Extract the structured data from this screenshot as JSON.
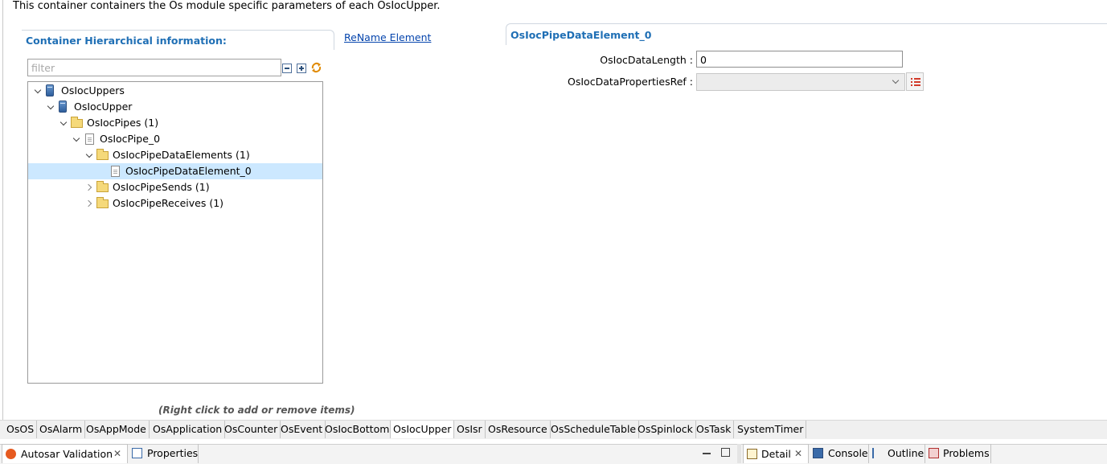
{
  "description": "This container containers the Os module specific parameters of each OsIocUpper.",
  "left_panel": {
    "title": "Container Hierarchical information:",
    "rename_link": "ReName Element",
    "filter_placeholder": "filter",
    "hint": "(Right click to add or remove items)",
    "tree": [
      {
        "label": "OsIocUppers",
        "expand": "down",
        "icon": "container-db-icon",
        "level": 0
      },
      {
        "label": "OsIocUpper",
        "expand": "down",
        "icon": "container-db-icon",
        "level": 1
      },
      {
        "label": "OsIocPipes (1)",
        "expand": "down",
        "icon": "folder-icon",
        "level": 2
      },
      {
        "label": "OsIocPipe_0",
        "expand": "down",
        "icon": "file-icon",
        "level": 3
      },
      {
        "label": "OsIocPipeDataElements (1)",
        "expand": "down",
        "icon": "folder-icon",
        "level": 4
      },
      {
        "label": "OsIocPipeDataElement_0",
        "expand": "none",
        "icon": "file-icon",
        "level": 5,
        "selected": true
      },
      {
        "label": "OsIocPipeSends (1)",
        "expand": "right",
        "icon": "folder-icon",
        "level": 4
      },
      {
        "label": "OsIocPipeReceives (1)",
        "expand": "right",
        "icon": "folder-icon",
        "level": 4
      }
    ]
  },
  "right_panel": {
    "title": "OsIocPipeDataElement_0",
    "fields": {
      "data_length_label": "OsIocDataLength :",
      "data_length_value": "0",
      "properties_ref_label": "OsIocDataPropertiesRef :",
      "properties_ref_value": ""
    }
  },
  "module_tabs": [
    "OsOS",
    "OsAlarm",
    "OsAppMode",
    "OsApplication",
    "OsCounter",
    "OsEvent",
    "OsIocBottom",
    "OsIocUpper",
    "OsIsr",
    "OsResource",
    "OsScheduleTable",
    "OsSpinlock",
    "OsTask",
    "SystemTimer"
  ],
  "active_module_tab": "OsIocUpper",
  "bottom_views": {
    "left": [
      "Autosar Validation",
      "Properties"
    ],
    "right": [
      "Detail",
      "Console",
      "Outline",
      "Problems"
    ]
  },
  "colors": {
    "accent_title": "#1f6fb5",
    "link": "#0645ad",
    "selection": "#cce8ff"
  }
}
